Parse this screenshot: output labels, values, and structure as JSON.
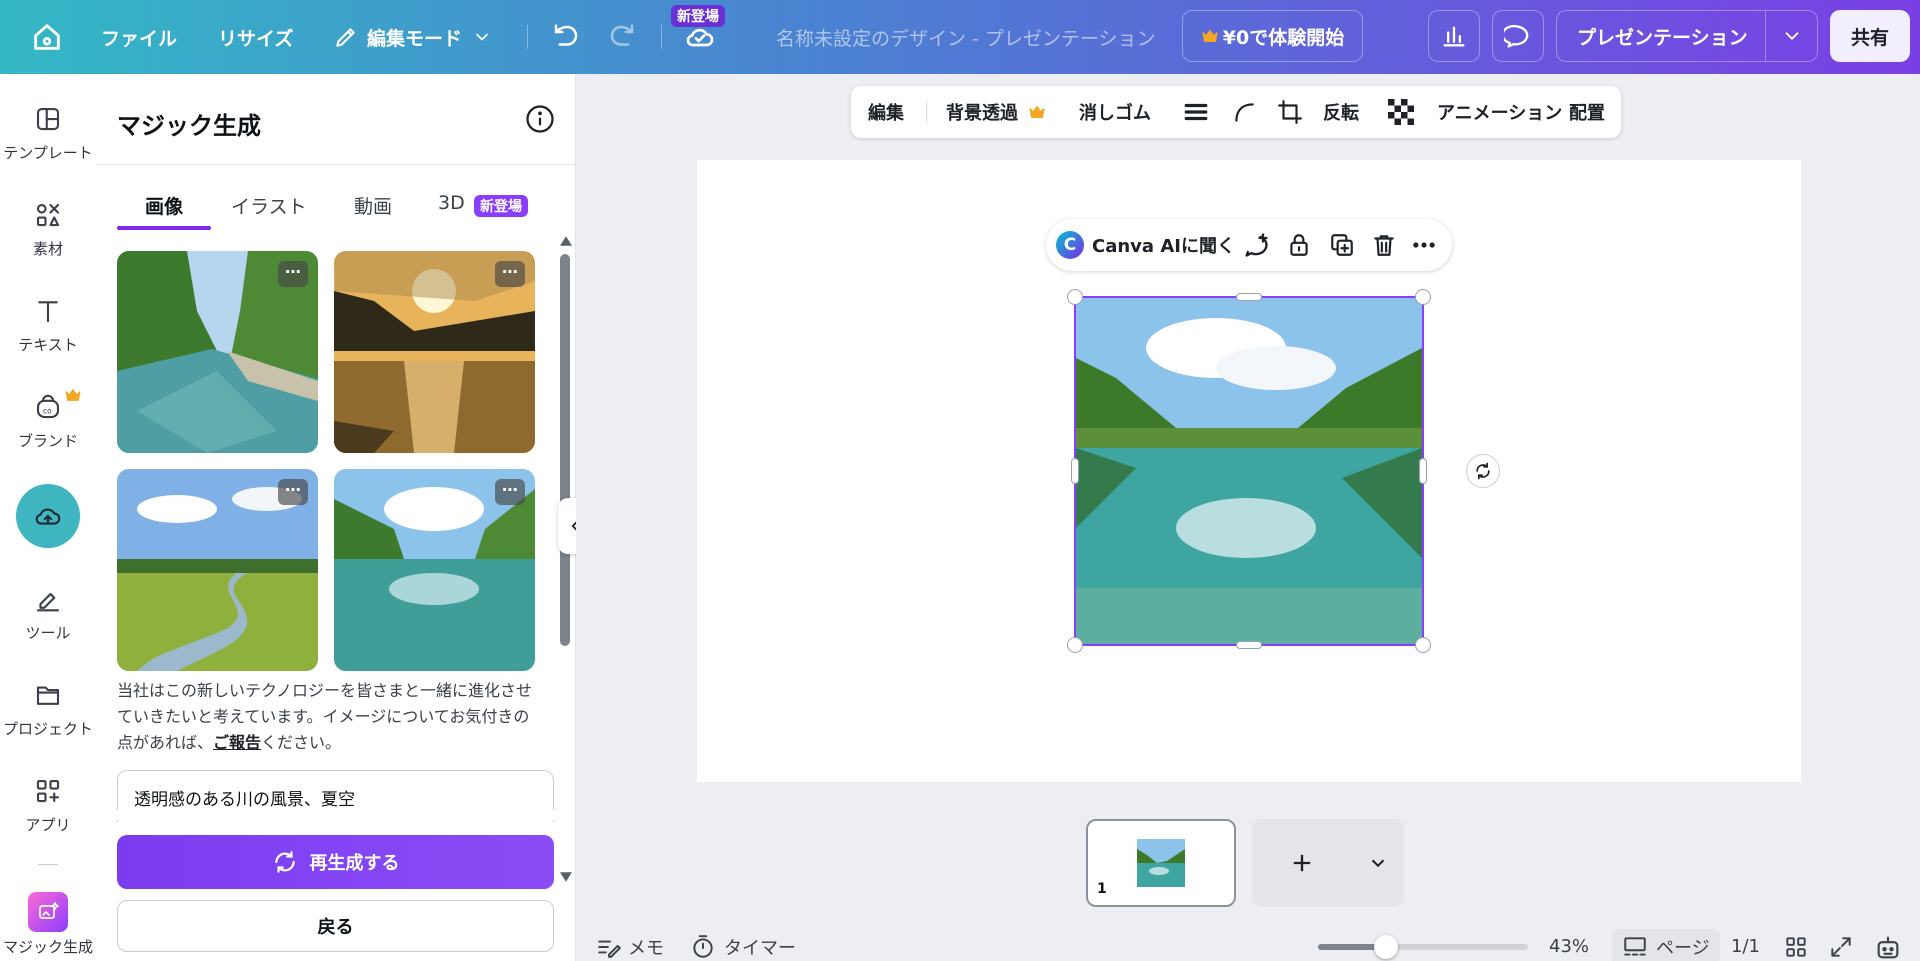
{
  "topbar": {
    "file": "ファイル",
    "resize": "リサイズ",
    "edit_mode": "編集モード",
    "new_badge": "新登場",
    "doc_title": "名称未設定のデザイン - プレゼンテーション",
    "trial": "¥0で体験開始",
    "present": "プレゼンテーション",
    "share": "共有"
  },
  "nav": {
    "items": [
      {
        "label": "テンプレート",
        "icon": "template-icon"
      },
      {
        "label": "素材",
        "icon": "elements-icon"
      },
      {
        "label": "テキスト",
        "icon": "text-icon"
      },
      {
        "label": "ブランド",
        "icon": "brand-icon"
      },
      {
        "label": "",
        "icon": "upload-cloud-icon"
      },
      {
        "label": "ツール",
        "icon": "draw-tool-icon"
      },
      {
        "label": "プロジェクト",
        "icon": "folder-icon"
      },
      {
        "label": "アプリ",
        "icon": "apps-icon"
      },
      {
        "label": "マジック生成",
        "icon": "magic-generate-icon"
      }
    ]
  },
  "panel": {
    "title": "マジック生成",
    "tabs": [
      "画像",
      "イラスト",
      "動画",
      "3D"
    ],
    "tab_badge": "新登場",
    "active_tab": "画像",
    "notice_text": "当社はこの新しいテクノロジーを皆さまと一緒に進化させていきたいと考えています。イメージについてお気付きの点があれば、",
    "notice_link": "ご報告",
    "notice_end": "ください。",
    "prompt_value": "透明感のある川の風景、夏空",
    "regenerate": "再生成する",
    "back": "戻る",
    "more_glyph": "⋯"
  },
  "context_toolbar": {
    "edit": "編集",
    "bg_remove": "背景透過",
    "eraser": "消しゴム",
    "flip": "反転",
    "animate": "アニメーション",
    "position": "配置"
  },
  "floating_toolbar": {
    "ask_ai": "Canva AIに聞く"
  },
  "bottom": {
    "notes": "メモ",
    "timer": "タイマー",
    "zoom": "43%",
    "zoom_fraction": 0.43,
    "pages": "ページ",
    "page_count": "1/1",
    "page_number": "1"
  },
  "colors": {
    "accent": "#7d2ae8",
    "button_purple": "#8b3dff",
    "selection": "#8b3dff",
    "crown": "#f5a623"
  }
}
